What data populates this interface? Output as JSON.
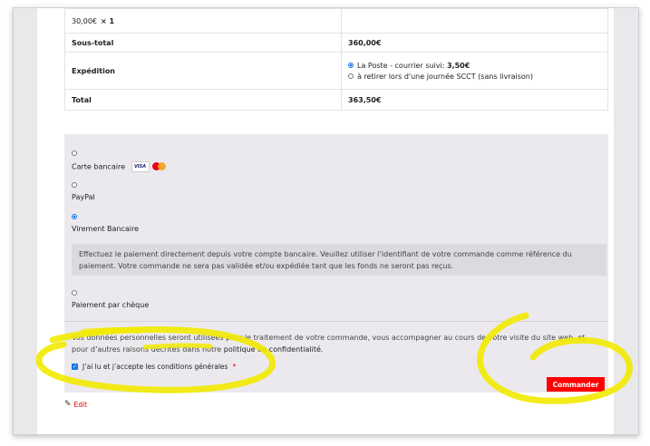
{
  "order_table": {
    "rows": [
      {
        "label": "30,00€",
        "qty": "× 1",
        "value": ""
      },
      {
        "label": "Sous-total",
        "value": "360,00€"
      },
      {
        "label": "Expédition",
        "options": [
          {
            "text_prefix": "La Poste - courrier suivi: ",
            "text_price": "3,50€",
            "selected": true
          },
          {
            "text": "à retirer lors d'une journée SCCT (sans livraison)",
            "selected": false
          }
        ]
      },
      {
        "label": "Total",
        "value": "363,50€"
      }
    ]
  },
  "payment": {
    "methods": [
      {
        "label": "Carte bancaire",
        "selected": false,
        "icons": [
          "visa-icon",
          "mastercard-icon"
        ],
        "visa_text": "VISA"
      },
      {
        "label": "PayPal",
        "selected": false
      },
      {
        "label": "Virement Bancaire",
        "selected": true
      },
      {
        "label": "Paiement par chèque",
        "selected": false
      }
    ],
    "selected_description": "Effectuez le paiement directement depuis votre compte bancaire. Veuillez utiliser l’identifiant de votre commande comme référence du paiement. Votre commande ne sera pas validée et/ou expédiée tant que les fonds ne seront pas reçus."
  },
  "privacy": {
    "text": "Vos données personnelles seront utilisées pour le traitement de votre commande, vous accompagner au cours de votre visite du site web, et pour d’autres raisons décrites dans notre ",
    "link": "politique de confidentialité",
    "end": "."
  },
  "terms": {
    "label": "J’ai lu et j’accepte les conditions générales",
    "required_mark": "*",
    "checked": true
  },
  "order_button": {
    "label": "Commander"
  },
  "edit_link": {
    "label": "Edit"
  },
  "colors": {
    "accent_red": "#ff0000",
    "radio_blue": "#1a73e8",
    "marker_yellow": "#f2ea00",
    "panel_bg": "#ebe9ee"
  }
}
